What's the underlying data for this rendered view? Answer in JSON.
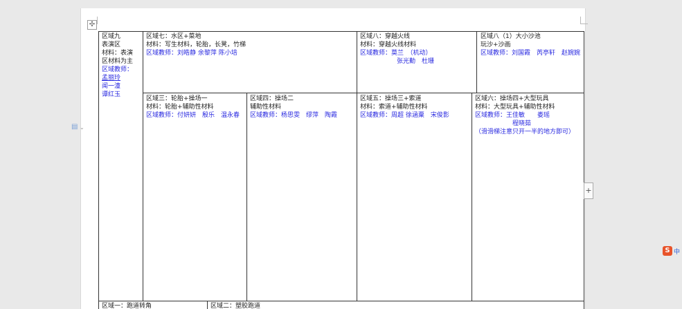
{
  "colors": {
    "teacher_blue": "#2a2ae0",
    "ime_orange": "#e8532a"
  },
  "icons": {
    "move": "move-handle-icon",
    "plus": "plus-icon",
    "ime": "sogou-ime-icon"
  },
  "ime": {
    "logo": "S",
    "label": "中"
  },
  "add_label": "+",
  "zone9": {
    "lines": [
      "区域九",
      "表演区",
      "材料：表演",
      "区材料为主"
    ],
    "teacher_label": "区域教师：",
    "teachers": [
      "孟丽玲",
      "闻一潼",
      "谭红玉"
    ]
  },
  "zone7": {
    "title": "区域七：水区+菜地",
    "material": "材料：写生材料，轮胎，长凳，竹梯",
    "teachers": "区域教师：刘皓静 余黎萍 陈小培"
  },
  "zone8": {
    "title": "区域八：穿越火线",
    "material": "材料：穿越火线材料",
    "teachers_1": "区域教师：莫兰　（机动）",
    "teachers_2": "张光勤　杜珊"
  },
  "zone8_1": {
    "title": "区域八（1）大小沙池",
    "material": "玩沙+沙画",
    "teachers": "区域教师：刘国霞　芮亭轩　赵婉婉"
  },
  "zone3": {
    "title": "区域三：轮胎+操场一",
    "material": "材料：轮胎+辅助性材料",
    "teachers": "区域教师：付妍妍　殷乐　温永春"
  },
  "zone4": {
    "title": "区域四：操场二",
    "material": "辅助性材料",
    "teachers": "区域教师：杨思雯　缪萍　陶霞"
  },
  "zone5": {
    "title": "区域五：操场三+索道",
    "material": "材料：索道+辅助性材料",
    "teachers": "区域教师：周超 徐涵粟　宋俊影"
  },
  "zone6": {
    "title": "区域六：操场四+大型玩具",
    "material": "材料：大型玩具+辅助性材料",
    "teachers_1": "区域教师：王佳敏　　娄瑶",
    "teachers_2": "程晓茹",
    "note": "（滑滑梯注意只开一半的地方即可）"
  },
  "zone1": {
    "title": "区域一：跑道转角"
  },
  "zone2": {
    "title": "区域二：塑胶跑道"
  }
}
